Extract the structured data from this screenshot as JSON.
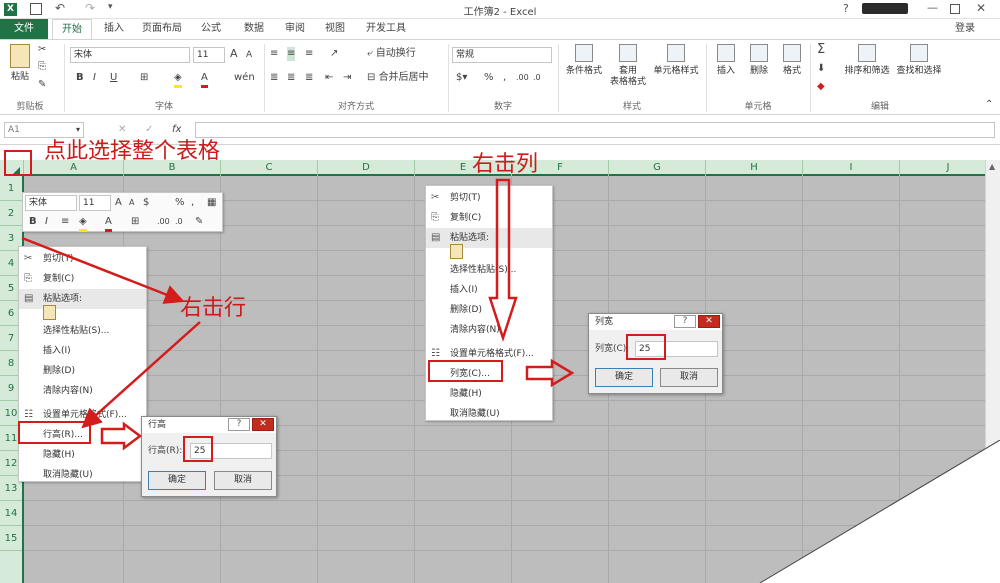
{
  "window": {
    "title": "工作簿2 - Excel",
    "login": "登录"
  },
  "tabs": [
    "文件",
    "开始",
    "插入",
    "页面布局",
    "公式",
    "数据",
    "审阅",
    "视图",
    "开发工具"
  ],
  "ribbon": {
    "clipboard": {
      "paste": "粘贴",
      "group": "剪贴板"
    },
    "font": {
      "name": "宋体",
      "size": "11",
      "group": "字体",
      "bold": "B",
      "italic": "I",
      "underline": "U",
      "grow": "A",
      "shrink": "A"
    },
    "alignment": {
      "wrap": "自动换行",
      "merge": "合并后居中",
      "group": "对齐方式"
    },
    "number": {
      "format": "常规",
      "percent": "%",
      "comma": ",",
      "group": "数字"
    },
    "styles": {
      "cond": "条件格式",
      "table": "套用",
      "table2": "表格格式",
      "cell": "单元格样式",
      "group": "样式"
    },
    "cells": {
      "insert": "插入",
      "delete": "删除",
      "format": "格式",
      "group": "单元格"
    },
    "editing": {
      "sort": "排序和筛选",
      "find": "查找和选择",
      "group": "编辑",
      "sigma": "Σ"
    }
  },
  "formula_bar": {
    "name_box": "A1",
    "fx": "fx",
    "cancel": "✕",
    "enter": "✓"
  },
  "columns": [
    "A",
    "B",
    "C",
    "D",
    "E",
    "F",
    "G",
    "H",
    "I",
    "J"
  ],
  "rows": [
    "1",
    "2",
    "3",
    "4",
    "5",
    "6",
    "7",
    "8",
    "9",
    "10",
    "11",
    "12",
    "13",
    "14",
    "15"
  ],
  "mini_toolbar": {
    "font": "宋体",
    "size": "11",
    "bold": "B",
    "italic": "I",
    "align": "≡",
    "percent": "%",
    "comma": ","
  },
  "row_menu": {
    "items": [
      "剪切(T)",
      "复制(C)",
      "粘贴选项:",
      "选择性粘贴(S)...",
      "插入(I)",
      "删除(D)",
      "清除内容(N)",
      "设置单元格格式(F)...",
      "行高(R)...",
      "隐藏(H)",
      "取消隐藏(U)"
    ]
  },
  "col_menu": {
    "items": [
      "剪切(T)",
      "复制(C)",
      "粘贴选项:",
      "选择性粘贴(S)...",
      "插入(I)",
      "删除(D)",
      "清除内容(N)",
      "设置单元格格式(F)...",
      "列宽(C)...",
      "隐藏(H)",
      "取消隐藏(U)"
    ]
  },
  "row_dialog": {
    "title": "行高",
    "label": "行高(R):",
    "value": "25",
    "ok": "确定",
    "cancel": "取消",
    "help": "?",
    "close": "✕"
  },
  "col_dialog": {
    "title": "列宽",
    "label": "列宽(C):",
    "value": "25",
    "ok": "确定",
    "cancel": "取消",
    "help": "?",
    "close": "✕"
  },
  "annotations": {
    "select_all": "点此选择整个表格",
    "right_click_col": "右击列",
    "right_click_row": "右击行"
  },
  "colors": {
    "excel_green": "#217346",
    "annotation_red": "#d41c1c",
    "header_bg": "#d5ead9",
    "sheet_gray": "#bdbdbd"
  }
}
